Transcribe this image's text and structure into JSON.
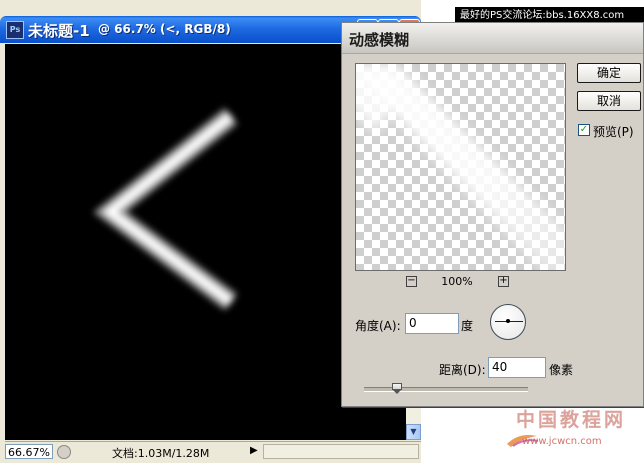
{
  "watermark_banner": "最好的PS交流论坛:bbs.16XX8.com",
  "document": {
    "app_icon": "ps-icon",
    "title": "未标题-1",
    "title_detail": "@ 66.7% (<, RGB/8)",
    "status": {
      "zoom": "66.67%",
      "doc_size": "文档:1.03M/1.28M"
    }
  },
  "dialog": {
    "title": "动感模糊",
    "ok_label": "确定",
    "cancel_label": "取消",
    "preview_label": "预览(P)",
    "preview_checked": true,
    "zoom_out": "−",
    "zoom_in": "+",
    "zoom_level": "100%",
    "angle_label": "角度(A):",
    "angle_value": "0",
    "angle_unit": "度",
    "distance_label": "距离(D):",
    "distance_value": "40",
    "distance_unit": "像素",
    "distance_slider_fraction": 0.2
  },
  "site_watermark": {
    "logo": "中国教程网",
    "url": "www.jcwcn.com"
  },
  "colors": {
    "canvas": "#000000",
    "titlebar": "#1f6be3",
    "dialog_bg": "#d4d0c8"
  }
}
